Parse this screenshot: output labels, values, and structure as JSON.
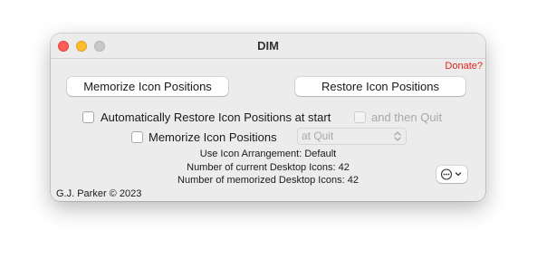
{
  "window": {
    "title": "DIM"
  },
  "donate_link": "Donate?",
  "buttons": {
    "memorize": "Memorize Icon Positions",
    "restore": "Restore Icon Positions"
  },
  "options": {
    "auto_restore": {
      "label": "Automatically Restore Icon Positions at start",
      "checked": false
    },
    "then_quit": {
      "label": "and then Quit",
      "checked": false,
      "enabled": false
    },
    "memorize": {
      "label": "Memorize Icon Positions",
      "checked": false
    },
    "memorize_when": {
      "selected": "at Quit",
      "enabled": false
    }
  },
  "info": {
    "arrangement": "Use Icon Arrangement: Default",
    "current_count": "Number of current Desktop Icons: 42",
    "memorized_count": "Number of memorized Desktop Icons: 42"
  },
  "footer": "G.J. Parker © 2023",
  "colors": {
    "donate": "#e0241b",
    "close": "#ff5f57",
    "minimize": "#febc2e",
    "zoom_inactive": "#c8c8c8"
  },
  "icons": {
    "action_menu": "ellipsis-circle-icon",
    "popup_arrows": "chevron-up-down-icon"
  }
}
